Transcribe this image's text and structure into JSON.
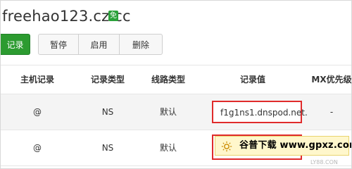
{
  "header": {
    "domain": "freehao123.cz.cc",
    "badge": "免"
  },
  "toolbar": {
    "add_label": "记录",
    "pause_label": "暂停",
    "enable_label": "启用",
    "delete_label": "删除"
  },
  "table": {
    "headers": {
      "host": "主机记录",
      "type": "记录类型",
      "line": "线路类型",
      "value": "记录值",
      "mx": "MX优先级"
    },
    "rows": [
      {
        "host": "@",
        "type": "NS",
        "line": "默认",
        "value": "f1g1ns1.dnspod.net.",
        "mx": "-"
      },
      {
        "host": "@",
        "type": "NS",
        "line": "默认",
        "value": "",
        "mx": ""
      }
    ]
  },
  "watermark": {
    "text": "谷普下载 www.gpxz.com",
    "faint": "LY88.CON"
  },
  "colors": {
    "green": "#2c9b30",
    "highlight_red": "#e02b2b",
    "watermark_bg": "#fff7cc"
  }
}
